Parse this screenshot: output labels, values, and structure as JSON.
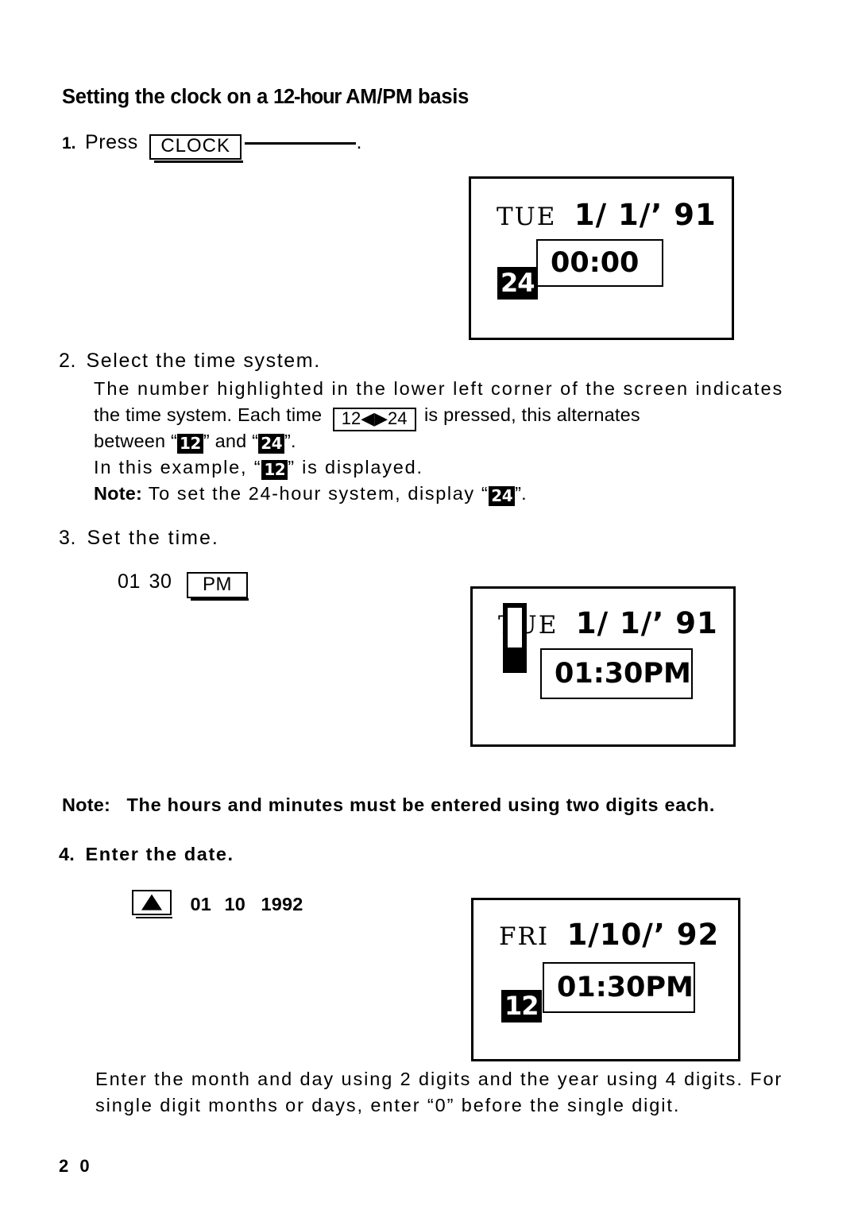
{
  "heading": {
    "part1": "Setting the clock on a ",
    "part2": "12-hour",
    "part3": " AM/PM basis"
  },
  "steps": {
    "step1": {
      "number": "1.",
      "verb": "Press",
      "key_label": "CLOCK",
      "trailing": "."
    },
    "step2": {
      "number": "2.",
      "title": "Select the time system.",
      "line1": "The number highlighted in the lower left corner of the screen indicates",
      "line2_a": "the time system. Each time",
      "key_label": "12◀▶24",
      "line2_b": "is pressed, this alternates",
      "line3_a": "between “",
      "line3_badge1": "12",
      "line3_b": "” and “",
      "line3_badge2": "24",
      "line3_c": "”.",
      "line4_a": "In this example, “",
      "line4_badge": "12",
      "line4_b": "” is displayed.",
      "line5_label": "Note:",
      "line5_a": " To set the 24-hour system, display “",
      "line5_badge": "24",
      "line5_b": "”."
    },
    "step3": {
      "number": "3.",
      "title": "Set the time.",
      "entry_hours": "01",
      "entry_minutes": "30",
      "key_label": "PM"
    },
    "note_two_digits": {
      "label": "Note:",
      "text": "The hours and minutes must be entered using two digits each."
    },
    "step4": {
      "number": "4.",
      "title": "Enter the date.",
      "key_icon": "up-triangle",
      "entry_month": "01",
      "entry_day": "10",
      "entry_year": "1992"
    },
    "closing": {
      "line1": "Enter the month and day using 2 digits and the year using 4 digits. For",
      "line2": "single digit months or days, enter “0” before the single digit."
    }
  },
  "displays": [
    {
      "name": "display-initial",
      "day_of_week": "TUE",
      "date": "1/ 1/’ 91",
      "time": "00:00",
      "system_badge": "24",
      "has_badge": true
    },
    {
      "name": "display-time-set",
      "day_of_week": "TUE",
      "date": "1/ 1/’ 91",
      "time": "01:30PM",
      "system_badge": "",
      "has_badge": false
    },
    {
      "name": "display-date-set",
      "day_of_week": "FRI",
      "date": "1/10/’ 92",
      "time": "01:30PM",
      "system_badge": "12",
      "has_badge": true
    }
  ],
  "page_number": "2 0",
  "colors": {
    "ink": "#000000",
    "paper": "#ffffff"
  }
}
